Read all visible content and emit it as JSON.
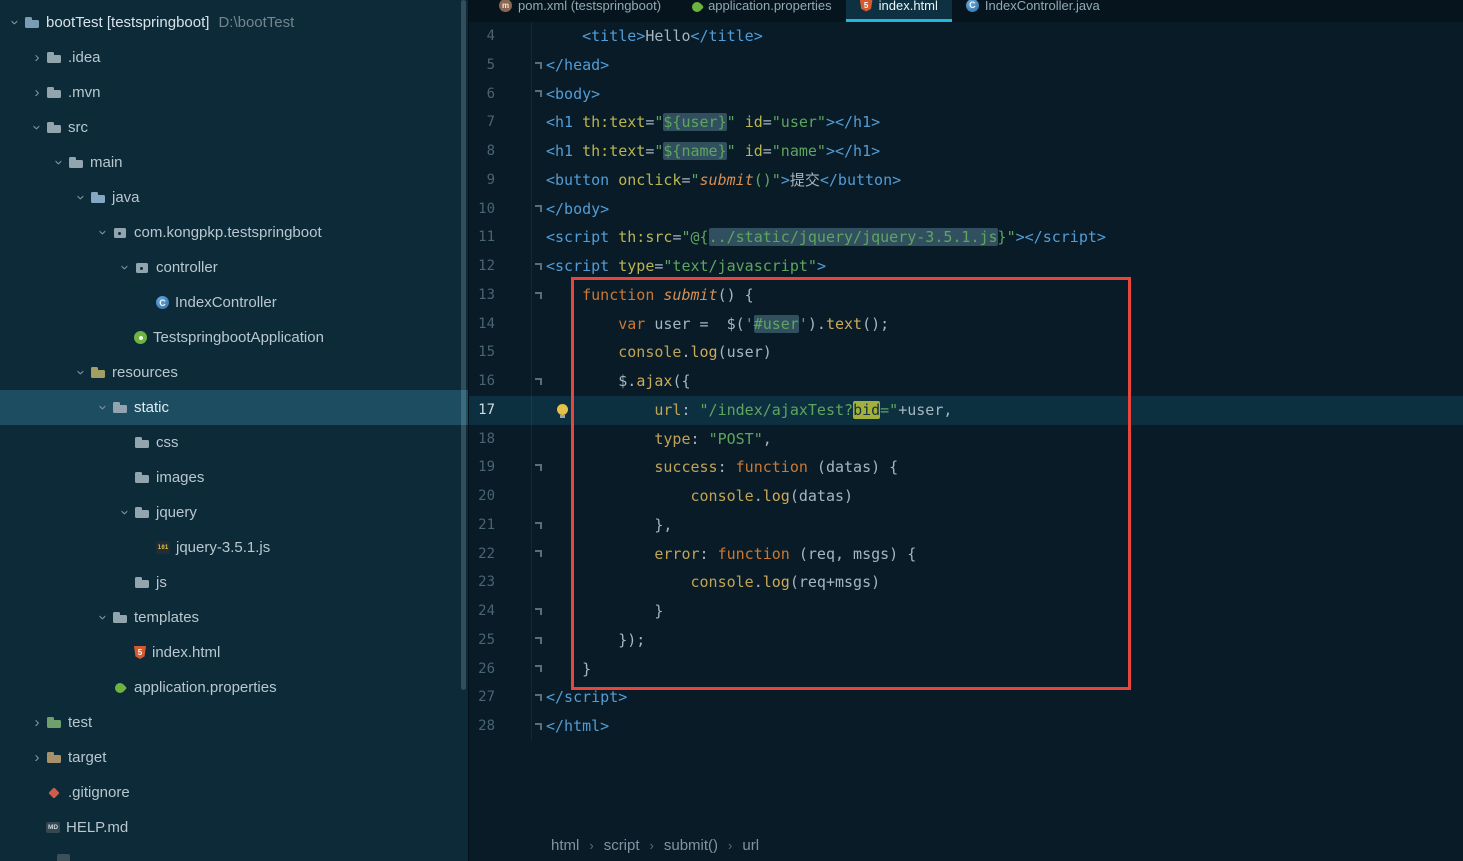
{
  "theme": {
    "accent": "#1fb9e0",
    "selection_bg": "#1d4d61",
    "annotation_red": "#e8463c",
    "sidebar_bg": "#0d2a38",
    "editor_bg": "#081b27",
    "tabbar_bg": "#05141d",
    "spring_green": "#6db33f",
    "html_orange": "#d65a31",
    "js_yellow": "#d9c04e"
  },
  "tree": {
    "root_label": "bootTest [testspringboot]",
    "root_path": "D:\\bootTest",
    "items": [
      {
        "label": ".idea",
        "level": 1,
        "chevron": "right",
        "icon": "folder"
      },
      {
        "label": ".mvn",
        "level": 1,
        "chevron": "right",
        "icon": "folder"
      },
      {
        "label": "src",
        "level": 1,
        "chevron": "down",
        "icon": "folder"
      },
      {
        "label": "main",
        "level": 2,
        "chevron": "down",
        "icon": "folder"
      },
      {
        "label": "java",
        "level": 3,
        "chevron": "down",
        "icon": "folder-src"
      },
      {
        "label": "com.kongpkp.testspringboot",
        "level": 4,
        "chevron": "down",
        "icon": "package"
      },
      {
        "label": "controller",
        "level": 5,
        "chevron": "down",
        "icon": "package"
      },
      {
        "label": "IndexController",
        "level": 6,
        "chevron": "none",
        "icon": "class"
      },
      {
        "label": "TestspringbootApplication",
        "level": 5,
        "chevron": "none",
        "icon": "springboot"
      },
      {
        "label": "resources",
        "level": 3,
        "chevron": "down",
        "icon": "folder-res"
      },
      {
        "label": "static",
        "level": 4,
        "chevron": "down",
        "icon": "folder",
        "selected": true
      },
      {
        "label": "css",
        "level": 5,
        "chevron": "none",
        "icon": "folder"
      },
      {
        "label": "images",
        "level": 5,
        "chevron": "none",
        "icon": "folder"
      },
      {
        "label": "jquery",
        "level": 5,
        "chevron": "down",
        "icon": "folder"
      },
      {
        "label": "jquery-3.5.1.js",
        "level": 6,
        "chevron": "none",
        "icon": "js"
      },
      {
        "label": "js",
        "level": 5,
        "chevron": "none",
        "icon": "folder"
      },
      {
        "label": "templates",
        "level": 4,
        "chevron": "down",
        "icon": "folder"
      },
      {
        "label": "index.html",
        "level": 5,
        "chevron": "none",
        "icon": "html"
      },
      {
        "label": "application.properties",
        "level": 4,
        "chevron": "none",
        "icon": "spring"
      },
      {
        "label": "test",
        "level": 1,
        "chevron": "right",
        "icon": "folder-test"
      },
      {
        "label": "target",
        "level": 1,
        "chevron": "right",
        "icon": "folder-target"
      },
      {
        "label": ".gitignore",
        "level": 1,
        "chevron": "none",
        "icon": "git"
      },
      {
        "label": "HELP.md",
        "level": 1,
        "chevron": "none",
        "icon": "md"
      }
    ]
  },
  "tabs": [
    {
      "label": "pom.xml (testspringboot)",
      "icon": "maven",
      "active": false
    },
    {
      "label": "application.properties",
      "icon": "spring",
      "active": false
    },
    {
      "label": "index.html",
      "icon": "html",
      "active": true
    },
    {
      "label": "IndexController.java",
      "icon": "class",
      "active": false
    }
  ],
  "editor": {
    "active_line": 17,
    "breadcrumbs": [
      "html",
      "script",
      "submit()",
      "url"
    ],
    "lines": [
      {
        "n": 4,
        "fold": false,
        "tokens": [
          {
            "c": "p",
            "t": "    "
          },
          {
            "c": "t",
            "t": "<title>"
          },
          {
            "c": "p",
            "t": "Hello"
          },
          {
            "c": "t",
            "t": "</title>"
          }
        ]
      },
      {
        "n": 5,
        "fold": true,
        "tokens": [
          {
            "c": "t",
            "t": "</head>"
          }
        ]
      },
      {
        "n": 6,
        "fold": true,
        "tokens": [
          {
            "c": "t",
            "t": "<body>"
          }
        ]
      },
      {
        "n": 7,
        "fold": false,
        "tokens": [
          {
            "c": "t",
            "t": "<h1"
          },
          {
            "c": "p",
            "t": " "
          },
          {
            "c": "a",
            "t": "th:text"
          },
          {
            "c": "p",
            "t": "="
          },
          {
            "c": "s",
            "t": "\""
          },
          {
            "c": "sh",
            "t": "${user}"
          },
          {
            "c": "s",
            "t": "\""
          },
          {
            "c": "p",
            "t": " "
          },
          {
            "c": "a",
            "t": "id"
          },
          {
            "c": "p",
            "t": "="
          },
          {
            "c": "s",
            "t": "\"user\""
          },
          {
            "c": "t",
            "t": "></h1>"
          }
        ]
      },
      {
        "n": 8,
        "fold": false,
        "tokens": [
          {
            "c": "t",
            "t": "<h1"
          },
          {
            "c": "p",
            "t": " "
          },
          {
            "c": "a",
            "t": "th:text"
          },
          {
            "c": "p",
            "t": "="
          },
          {
            "c": "s",
            "t": "\""
          },
          {
            "c": "sh",
            "t": "${name}"
          },
          {
            "c": "s",
            "t": "\""
          },
          {
            "c": "p",
            "t": " "
          },
          {
            "c": "a",
            "t": "id"
          },
          {
            "c": "p",
            "t": "="
          },
          {
            "c": "s",
            "t": "\"name\""
          },
          {
            "c": "t",
            "t": "></h1>"
          }
        ]
      },
      {
        "n": 9,
        "fold": false,
        "tokens": [
          {
            "c": "t",
            "t": "<button"
          },
          {
            "c": "p",
            "t": " "
          },
          {
            "c": "a",
            "t": "onclick"
          },
          {
            "c": "p",
            "t": "="
          },
          {
            "c": "s",
            "t": "\""
          },
          {
            "c": "f",
            "t": "submit"
          },
          {
            "c": "s",
            "t": "()\""
          },
          {
            "c": "t",
            "t": ">"
          },
          {
            "c": "p",
            "t": "提交"
          },
          {
            "c": "t",
            "t": "</button>"
          }
        ]
      },
      {
        "n": 10,
        "fold": true,
        "tokens": [
          {
            "c": "t",
            "t": "</body>"
          }
        ]
      },
      {
        "n": 11,
        "fold": false,
        "tokens": [
          {
            "c": "t",
            "t": "<script"
          },
          {
            "c": "p",
            "t": " "
          },
          {
            "c": "a",
            "t": "th:src"
          },
          {
            "c": "p",
            "t": "="
          },
          {
            "c": "s",
            "t": "\"@{"
          },
          {
            "c": "sh",
            "t": "../static/jquery/jquery-3.5.1.js"
          },
          {
            "c": "s",
            "t": "}\""
          },
          {
            "c": "t",
            "t": "></script>"
          }
        ]
      },
      {
        "n": 12,
        "fold": true,
        "tokens": [
          {
            "c": "t",
            "t": "<script"
          },
          {
            "c": "p",
            "t": " "
          },
          {
            "c": "a",
            "t": "type"
          },
          {
            "c": "p",
            "t": "="
          },
          {
            "c": "s",
            "t": "\"text/javascript\""
          },
          {
            "c": "t",
            "t": ">"
          }
        ]
      },
      {
        "n": 13,
        "fold": true,
        "tokens": [
          {
            "c": "p",
            "t": "    "
          },
          {
            "c": "k",
            "t": "function "
          },
          {
            "c": "f",
            "t": "submit"
          },
          {
            "c": "p",
            "t": "() {"
          }
        ]
      },
      {
        "n": 14,
        "fold": false,
        "tokens": [
          {
            "c": "p",
            "t": "        "
          },
          {
            "c": "k",
            "t": "var"
          },
          {
            "c": "p",
            "t": " user =  $("
          },
          {
            "c": "s",
            "t": "'"
          },
          {
            "c": "sh",
            "t": "#user"
          },
          {
            "c": "s",
            "t": "'"
          },
          {
            "c": "p",
            "t": ")."
          },
          {
            "c": "m",
            "t": "text"
          },
          {
            "c": "p",
            "t": "();"
          }
        ]
      },
      {
        "n": 15,
        "fold": false,
        "tokens": [
          {
            "c": "p",
            "t": "        "
          },
          {
            "c": "pr",
            "t": "console"
          },
          {
            "c": "p",
            "t": "."
          },
          {
            "c": "m",
            "t": "log"
          },
          {
            "c": "p",
            "t": "(user)"
          }
        ]
      },
      {
        "n": 16,
        "fold": true,
        "tokens": [
          {
            "c": "p",
            "t": "        $."
          },
          {
            "c": "m",
            "t": "ajax"
          },
          {
            "c": "p",
            "t": "({"
          }
        ]
      },
      {
        "n": 17,
        "fold": false,
        "bulb": true,
        "tokens": [
          {
            "c": "p",
            "t": "            "
          },
          {
            "c": "pr",
            "t": "url"
          },
          {
            "c": "p",
            "t": ": "
          },
          {
            "c": "s",
            "t": "\"/index/ajaxTest?"
          },
          {
            "c": "wh",
            "t": "bid"
          },
          {
            "c": "s",
            "t": "=\""
          },
          {
            "c": "p",
            "t": "+user,"
          }
        ]
      },
      {
        "n": 18,
        "fold": false,
        "tokens": [
          {
            "c": "p",
            "t": "            "
          },
          {
            "c": "pr",
            "t": "type"
          },
          {
            "c": "p",
            "t": ": "
          },
          {
            "c": "s",
            "t": "\"POST\""
          },
          {
            "c": "p",
            "t": ","
          }
        ]
      },
      {
        "n": 19,
        "fold": true,
        "tokens": [
          {
            "c": "p",
            "t": "            "
          },
          {
            "c": "pr",
            "t": "success"
          },
          {
            "c": "p",
            "t": ": "
          },
          {
            "c": "k",
            "t": "function"
          },
          {
            "c": "p",
            "t": " (datas) {"
          }
        ]
      },
      {
        "n": 20,
        "fold": false,
        "tokens": [
          {
            "c": "p",
            "t": "                "
          },
          {
            "c": "pr",
            "t": "console"
          },
          {
            "c": "p",
            "t": "."
          },
          {
            "c": "m",
            "t": "log"
          },
          {
            "c": "p",
            "t": "(datas)"
          }
        ]
      },
      {
        "n": 21,
        "fold": true,
        "tokens": [
          {
            "c": "p",
            "t": "            },"
          }
        ]
      },
      {
        "n": 22,
        "fold": true,
        "tokens": [
          {
            "c": "p",
            "t": "            "
          },
          {
            "c": "pr",
            "t": "error"
          },
          {
            "c": "p",
            "t": ": "
          },
          {
            "c": "k",
            "t": "function"
          },
          {
            "c": "p",
            "t": " (req, msgs) {"
          }
        ]
      },
      {
        "n": 23,
        "fold": false,
        "tokens": [
          {
            "c": "p",
            "t": "                "
          },
          {
            "c": "pr",
            "t": "console"
          },
          {
            "c": "p",
            "t": "."
          },
          {
            "c": "m",
            "t": "log"
          },
          {
            "c": "p",
            "t": "(req+msgs)"
          }
        ]
      },
      {
        "n": 24,
        "fold": true,
        "tokens": [
          {
            "c": "p",
            "t": "            }"
          }
        ]
      },
      {
        "n": 25,
        "fold": true,
        "tokens": [
          {
            "c": "p",
            "t": "        });"
          }
        ]
      },
      {
        "n": 26,
        "fold": true,
        "tokens": [
          {
            "c": "p",
            "t": "    }"
          }
        ]
      },
      {
        "n": 27,
        "fold": true,
        "tokens": [
          {
            "c": "t",
            "t": "</script>"
          }
        ]
      },
      {
        "n": 28,
        "fold": true,
        "tokens": [
          {
            "c": "t",
            "t": "</html>"
          }
        ]
      }
    ]
  }
}
